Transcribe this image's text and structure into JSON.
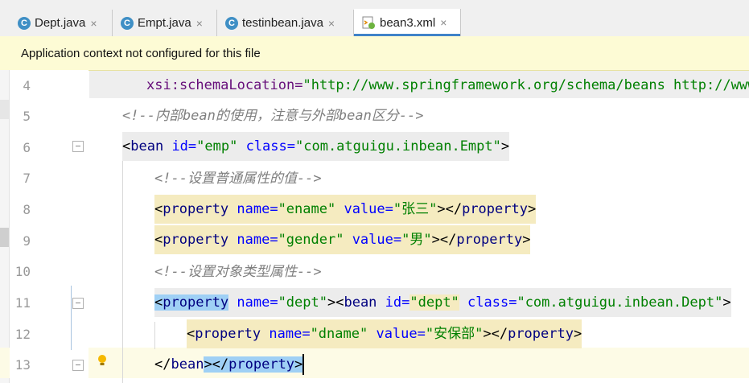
{
  "tabs": [
    {
      "label": "Dept.java",
      "icon": "java-class-icon",
      "glyph": "C",
      "close": "×"
    },
    {
      "label": "Empt.java",
      "icon": "java-class-icon",
      "glyph": "C",
      "close": "×"
    },
    {
      "label": "testinbean.java",
      "icon": "java-test-class-icon",
      "glyph": "C",
      "close": "×"
    },
    {
      "label": "bean3.xml",
      "icon": "spring-xml-icon",
      "close": "×"
    }
  ],
  "banner": {
    "text": "Application context not configured for this file"
  },
  "line_numbers": [
    "4",
    "5",
    "6",
    "7",
    "8",
    "9",
    "10",
    "11",
    "12",
    "13"
  ],
  "lines": {
    "l4": {
      "attr": "xsi:schemaLocation=",
      "val": "\"http://www.springframework.org/schema/beans http://www."
    },
    "l5": {
      "comment": "<!--内部bean的使用，注意与外部bean区分-->"
    },
    "l6": {
      "open": "<",
      "tag": "bean",
      "a1": " id=",
      "v1": "\"emp\"",
      "a2": " class=",
      "v2": "\"com.atguigu.inbean.Empt\"",
      "close": ">"
    },
    "l7": {
      "comment": "<!--设置普通属性的值-->"
    },
    "l8": {
      "open": "<",
      "tag": "property",
      "a1": " name=",
      "v1": "\"ename\"",
      "a2": " value=",
      "v2": "\"张三\"",
      "end": "></",
      "etag": "property",
      "close": ">"
    },
    "l9": {
      "open": "<",
      "tag": "property",
      "a1": " name=",
      "v1": "\"gender\"",
      "a2": " value=",
      "v2": "\"男\"",
      "end": "></",
      "etag": "property",
      "close": ">"
    },
    "l10": {
      "comment": "<!--设置对象类型属性-->"
    },
    "l11": {
      "open": "<",
      "tag": "property",
      "a1": " name=",
      "v1": "\"dept\"",
      "mid": "><",
      "tag2": "bean",
      "a2": " id=",
      "v2": "\"dept\"",
      "a3": " class=",
      "v3": "\"com.atguigu.inbean.Dept\"",
      "close": ">"
    },
    "l12": {
      "open": "<",
      "tag": "property",
      "a1": " name=",
      "v1": "\"dname\"",
      "a2": " value=",
      "v2": "\"安保部\"",
      "end": "></",
      "etag": "property",
      "close": ">"
    },
    "l13": {
      "open": "</",
      "tag": "bean",
      "mid": "></",
      "tag2": "property",
      "close": ">"
    }
  },
  "colors": {
    "tag": "#000080",
    "attr": "#0000ff",
    "value": "#008000",
    "comment": "#7f7f7f",
    "banner_bg": "#fdfbd5"
  }
}
